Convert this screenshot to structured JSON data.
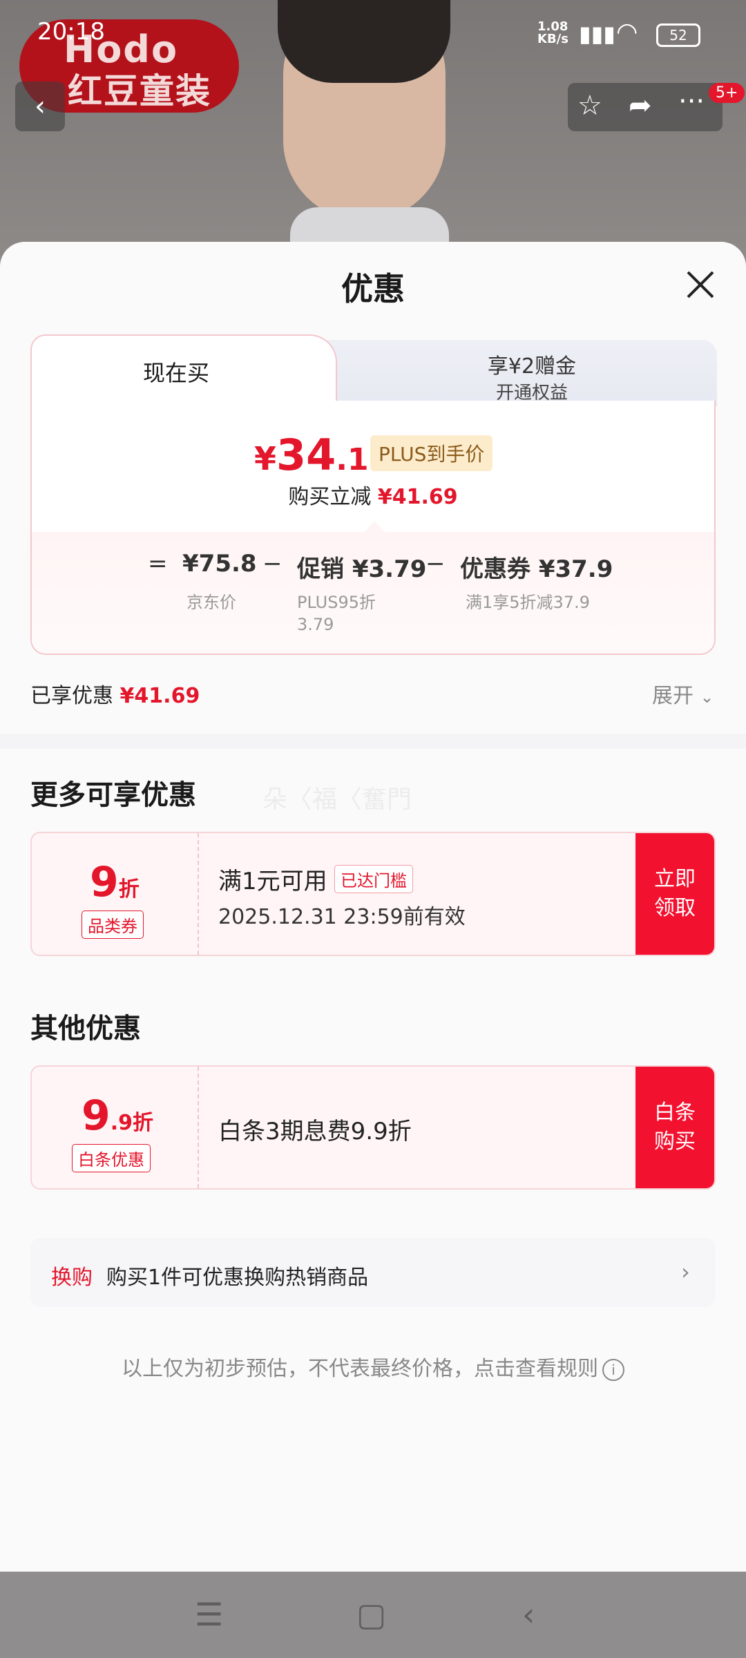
{
  "status_bar": {
    "time": "20:18",
    "net_speed": "1.08\nKB/s",
    "battery": "52"
  },
  "background": {
    "brand_line1": "Hodo",
    "brand_line2": "红豆童装",
    "notif_badge": "5+"
  },
  "sheet": {
    "title": "优惠",
    "tabs": [
      {
        "label": "现在买"
      },
      {
        "label": "享¥2赠金",
        "sub": "开通权益"
      }
    ],
    "price": {
      "yen": "¥",
      "int": "34",
      "dec": ".11",
      "badge": "PLUS到手价"
    },
    "reduce": {
      "label": "购买立减",
      "value": "¥41.69"
    },
    "calc": {
      "eq": "=",
      "jd_price": "¥75.8",
      "jd_label": "京东价",
      "minus1": "−",
      "promo": "促销 ¥3.79",
      "promo_sub": "PLUS95折\n3.79",
      "minus2": "−",
      "coupon": "优惠券 ¥37.9",
      "coupon_sub": "满1享5折减37.9"
    },
    "enjoyed": {
      "label": "已享优惠",
      "value": "¥41.69"
    },
    "expand": "展开"
  },
  "more": {
    "title": "更多可享优惠",
    "watermark": "朵〈福〈奮門",
    "coupon": {
      "big": "9",
      "unit": "折",
      "tag": "品类券",
      "main": "满1元可用",
      "threshold": "已达门槛",
      "validity": "2025.12.31 23:59前有效",
      "button": "立即\n领取"
    }
  },
  "other": {
    "title": "其他优惠",
    "coupon": {
      "big": "9",
      "small": ".9折",
      "tag": "白条优惠",
      "main": "白条3期息费9.9折",
      "button": "白条\n购买"
    }
  },
  "swap": {
    "label": "换购",
    "text": "购买1件可优惠换购热销商品"
  },
  "disclaimer": "以上仅为初步预估，不代表最终价格，点击查看规则"
}
